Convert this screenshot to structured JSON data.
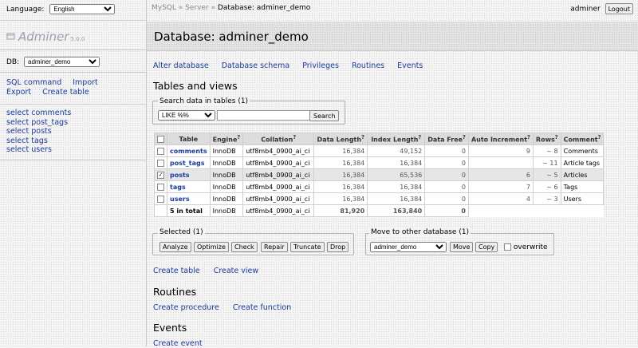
{
  "left": {
    "language_label": "Language:",
    "language_value": "English",
    "logo_name": "Adminer",
    "logo_version": "5.0.0",
    "db_label": "DB:",
    "db_value": "adminer_demo",
    "links": [
      "SQL command",
      "Import",
      "Export",
      "Create table"
    ],
    "select_items": [
      "select comments",
      "select post_tags",
      "select posts",
      "select tags",
      "select users"
    ]
  },
  "header": {
    "breadcrumb_1": "MySQL",
    "breadcrumb_sep": "»",
    "breadcrumb_2": "Server",
    "breadcrumb_3": "Database: adminer_demo",
    "user": "adminer",
    "logout": "Logout"
  },
  "main": {
    "title": "Database: adminer_demo",
    "nav": [
      "Alter database",
      "Database schema",
      "Privileges",
      "Routines",
      "Events"
    ],
    "tables_heading": "Tables and views",
    "search": {
      "legend": "Search data in tables (1)",
      "operator": "LIKE %%",
      "value": "",
      "button": "Search"
    },
    "table": {
      "headers": [
        "Table",
        "Engine",
        "Collation",
        "Data Length",
        "Index Length",
        "Data Free",
        "Auto Increment",
        "Rows",
        "Comment"
      ],
      "rows": [
        {
          "checked": false,
          "name": "comments",
          "engine": "InnoDB",
          "collation": "utf8mb4_0900_ai_ci",
          "data_length": "16,384",
          "index_length": "49,152",
          "data_free": "0",
          "auto_increment": "9",
          "rows": "~ 8",
          "comment": "Comments"
        },
        {
          "checked": false,
          "name": "post_tags",
          "engine": "InnoDB",
          "collation": "utf8mb4_0900_ai_ci",
          "data_length": "16,384",
          "index_length": "16,384",
          "data_free": "0",
          "auto_increment": "",
          "rows": "~ 11",
          "comment": "Article tags"
        },
        {
          "checked": true,
          "name": "posts",
          "engine": "InnoDB",
          "collation": "utf8mb4_0900_ai_ci",
          "data_length": "16,384",
          "index_length": "65,536",
          "data_free": "0",
          "auto_increment": "6",
          "rows": "~ 5",
          "comment": "Articles"
        },
        {
          "checked": false,
          "name": "tags",
          "engine": "InnoDB",
          "collation": "utf8mb4_0900_ai_ci",
          "data_length": "16,384",
          "index_length": "16,384",
          "data_free": "0",
          "auto_increment": "7",
          "rows": "~ 6",
          "comment": "Tags"
        },
        {
          "checked": false,
          "name": "users",
          "engine": "InnoDB",
          "collation": "utf8mb4_0900_ai_ci",
          "data_length": "16,384",
          "index_length": "16,384",
          "data_free": "0",
          "auto_increment": "4",
          "rows": "~ 3",
          "comment": "Users"
        }
      ],
      "total": {
        "name": "5 in total",
        "engine": "InnoDB",
        "collation": "utf8mb4_0900_ai_ci",
        "data_length": "81,920",
        "index_length": "163,840",
        "data_free": "0"
      }
    },
    "selected": {
      "legend": "Selected (1)",
      "buttons": [
        "Analyze",
        "Optimize",
        "Check",
        "Repair",
        "Truncate",
        "Drop"
      ]
    },
    "move": {
      "legend": "Move to other database (1)",
      "db_value": "adminer_demo",
      "move_button": "Move",
      "copy_button": "Copy",
      "overwrite_label": "overwrite"
    },
    "create_links": [
      "Create table",
      "Create view"
    ],
    "routines_heading": "Routines",
    "routine_links": [
      "Create procedure",
      "Create function"
    ],
    "events_heading": "Events",
    "event_link": "Create event"
  }
}
